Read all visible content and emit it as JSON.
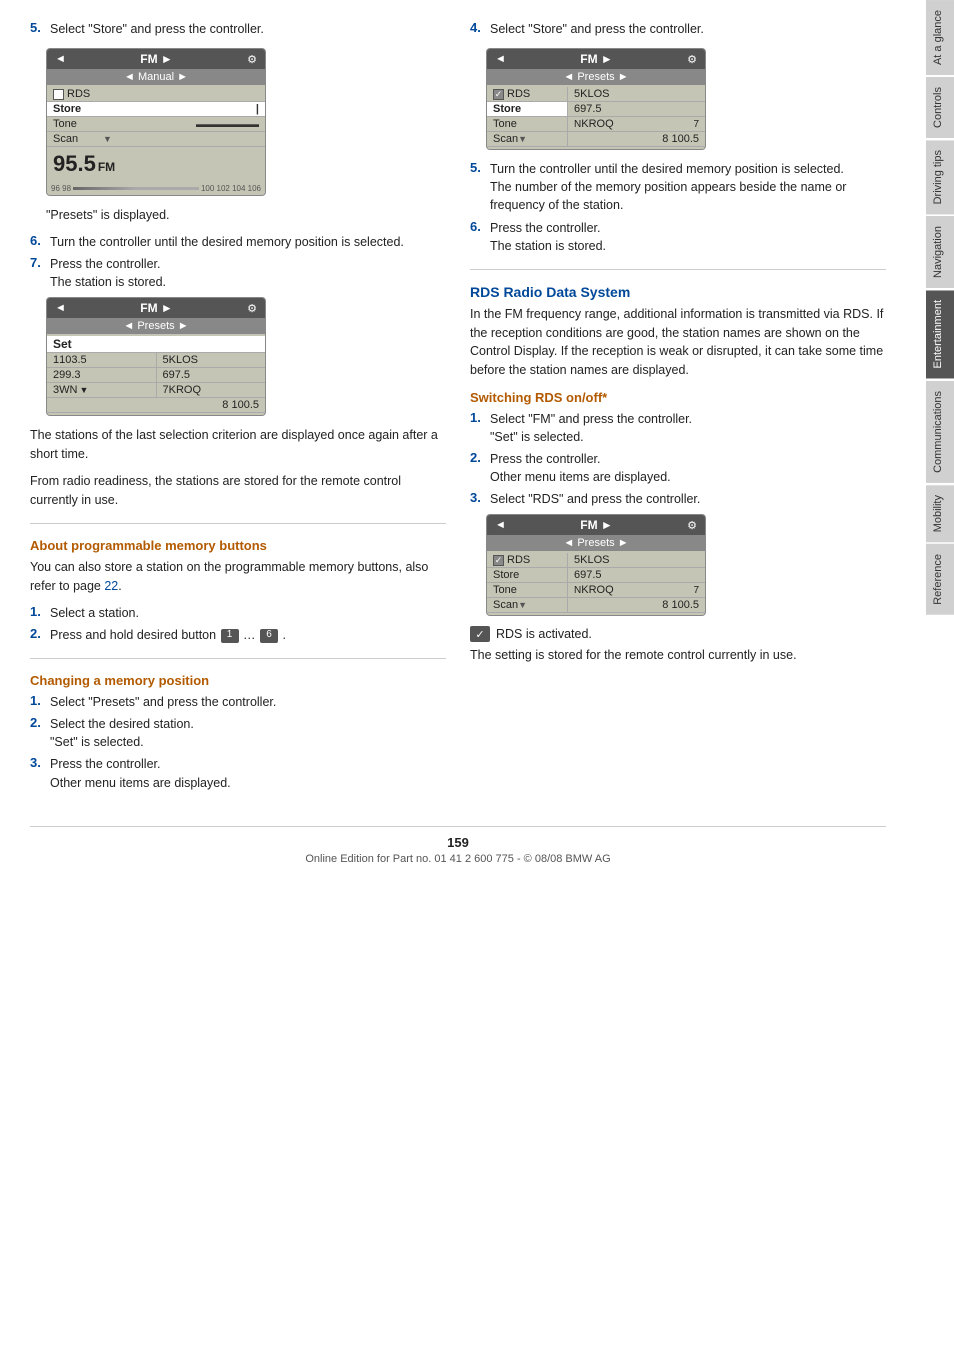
{
  "page": {
    "number": "159",
    "footer": "Online Edition for Part no. 01 41 2 600 775 - © 08/08 BMW AG"
  },
  "side_tabs": [
    {
      "id": "at-a-glance",
      "label": "At a glance",
      "active": false
    },
    {
      "id": "controls",
      "label": "Controls",
      "active": false
    },
    {
      "id": "driving-tips",
      "label": "Driving tips",
      "active": false
    },
    {
      "id": "navigation",
      "label": "Navigation",
      "active": false
    },
    {
      "id": "entertainment",
      "label": "Entertainment",
      "active": true
    },
    {
      "id": "communications",
      "label": "Communications",
      "active": false
    },
    {
      "id": "mobility",
      "label": "Mobility",
      "active": false
    },
    {
      "id": "reference",
      "label": "Reference",
      "active": false
    }
  ],
  "left_col": {
    "step5_label": "5.",
    "step5_text": "Select \"Store\" and press the controller.",
    "display1": {
      "top_left": "◄",
      "top_label": "FM ►",
      "submenu": "◄ Manual ►",
      "items": [
        {
          "label": "RDS",
          "value": "",
          "checkbox": true,
          "checked": false
        },
        {
          "label": "Store",
          "value": "",
          "selected": true
        },
        {
          "label": "Tone",
          "value": "",
          "freq_bar": true
        },
        {
          "label": "Scan",
          "value": "▼",
          "has_arrow": true
        }
      ],
      "freq_big": "95.5",
      "freq_unit": "FM"
    },
    "presets_displayed": "\"Presets\" is displayed.",
    "step6_label": "6.",
    "step6_text": "Turn the controller until the desired memory position is selected.",
    "step7_label": "7.",
    "step7_text": "Press the controller.",
    "step7_sub": "The station is stored.",
    "display2": {
      "top_left": "◄",
      "top_label": "FM ►",
      "submenu": "◄ Presets ►",
      "set_label": "Set",
      "presets_left": [
        {
          "num": "1",
          "station": "103.5"
        },
        {
          "num": "2",
          "station": "99.3"
        },
        {
          "num": "3",
          "station": "WN"
        }
      ],
      "presets_right": [
        {
          "num": "5",
          "station": "KLOS"
        },
        {
          "num": "6",
          "station": "97.5"
        },
        {
          "num": "7",
          "station": "KROQ"
        }
      ],
      "last_row": "8  100.5"
    },
    "para1": "The stations of the last selection criterion are displayed once again after a short time.",
    "para2": "From radio readiness, the stations are stored for the remote control currently in use.",
    "heading_programmable": "About programmable memory buttons",
    "para_programmable": "You can also store a station on the programmable memory buttons, also refer to page 22.",
    "prog_step1_label": "1.",
    "prog_step1_text": "Select a station.",
    "prog_step2_label": "2.",
    "prog_step2_text": "Press and hold desired button",
    "btn1": "1",
    "btn6": "6",
    "heading_changing": "Changing a memory position",
    "change_step1_label": "1.",
    "change_step1_text": "Select \"Presets\" and press the controller.",
    "change_step2_label": "2.",
    "change_step2_text": "Select the desired station.",
    "change_step2_sub": "\"Set\" is selected.",
    "change_step3_label": "3.",
    "change_step3_text": "Press the controller.",
    "change_step3_sub": "Other menu items are displayed."
  },
  "right_col": {
    "step4_label": "4.",
    "step4_text": "Select \"Store\" and press the controller.",
    "display3": {
      "top_left": "◄",
      "top_label": "FM ►",
      "submenu": "◄ Presets ►",
      "items": [
        {
          "label": "RDS",
          "value": "",
          "checkbox": true,
          "checked": true
        },
        {
          "label": "Store",
          "value": "",
          "selected": true
        },
        {
          "label": "Tone",
          "value": ""
        },
        {
          "label": "Scan",
          "value": "▼",
          "has_arrow": true
        }
      ],
      "presets_right": [
        {
          "num": "5",
          "station": "KLOS"
        },
        {
          "num": "6",
          "station": "97.5"
        },
        {
          "num": "7",
          "station": "KROQ"
        }
      ],
      "last_row": "8  100.5"
    },
    "step5_label": "5.",
    "step5_text": "Turn the controller until the desired memory position is selected.",
    "step5_sub1": "The number of the memory position appears beside the name or frequency of the station.",
    "step6_label": "6.",
    "step6_text": "Press the controller.",
    "step6_sub": "The station is stored.",
    "heading_rds": "RDS Radio Data System",
    "para_rds": "In the FM frequency range, additional information is transmitted via RDS. If the reception conditions are good, the station names are shown on the Control Display. If the reception is weak or disrupted, it can take some time before the station names are displayed.",
    "heading_switching": "Switching RDS on/off*",
    "switch_step1_label": "1.",
    "switch_step1_text": "Select \"FM\" and press the controller.",
    "switch_step1_sub": "\"Set\" is selected.",
    "switch_step2_label": "2.",
    "switch_step2_text": "Press the controller.",
    "switch_step2_sub": "Other menu items are displayed.",
    "switch_step3_label": "3.",
    "switch_step3_text": "Select \"RDS\" and press the controller.",
    "display4": {
      "top_left": "◄",
      "top_label": "FM ►",
      "submenu": "◄ Presets ►",
      "items": [
        {
          "label": "RDS",
          "value": "",
          "checkbox": true,
          "checked": true
        },
        {
          "label": "Store",
          "value": ""
        },
        {
          "label": "Tone",
          "value": ""
        },
        {
          "label": "Scan",
          "value": "▼",
          "has_arrow": true
        }
      ],
      "presets_right": [
        {
          "num": "5",
          "station": "KLOS"
        },
        {
          "num": "6",
          "station": "97.5"
        },
        {
          "num": "7",
          "station": "KROQ"
        }
      ],
      "last_row": "8  100.5"
    },
    "rds_activated": "RDS is activated.",
    "para_setting": "The setting is stored for the remote control currently in use."
  }
}
